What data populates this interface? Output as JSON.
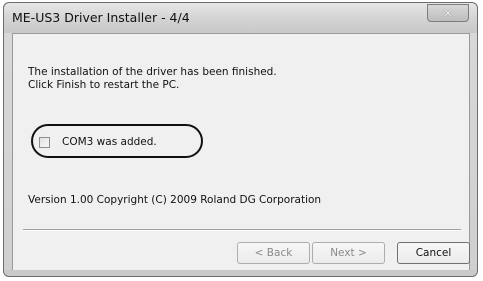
{
  "window": {
    "title": "ME-US3 Driver Installer - 4/4",
    "close_glyph": "✕"
  },
  "content": {
    "message_line1": "The installation of the driver has been finished.",
    "message_line2": "Click Finish to restart the PC.",
    "checkbox_label": "COM3 was added.",
    "checkbox_checked": false,
    "version_text": "Version 1.00  Copyright (C) 2009 Roland DG Corporation"
  },
  "buttons": {
    "back": "< Back",
    "next": "Next >",
    "cancel": "Cancel"
  }
}
